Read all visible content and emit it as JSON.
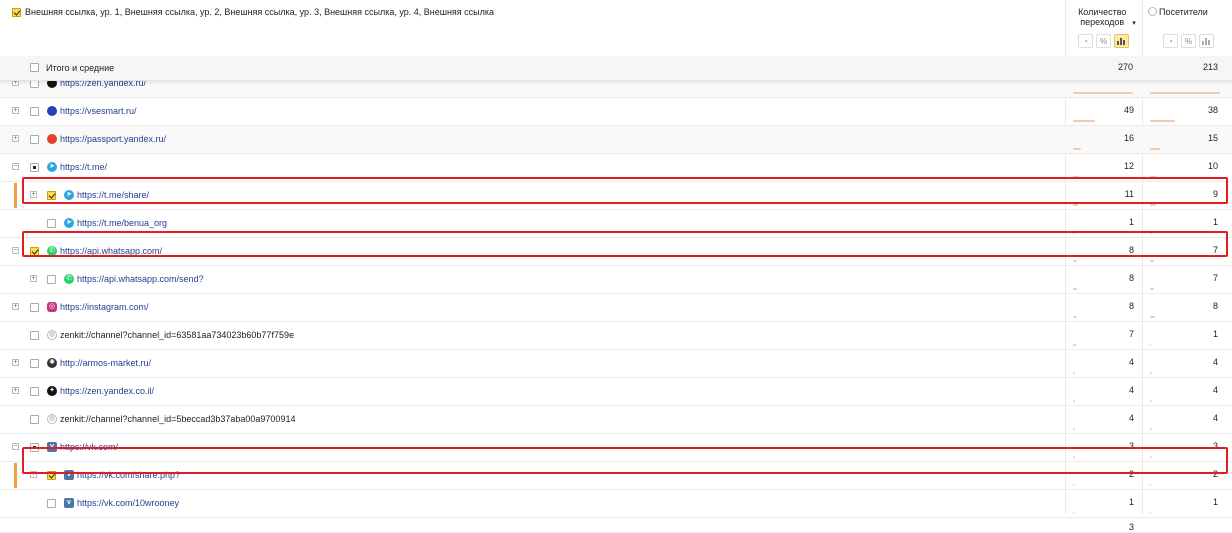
{
  "header": {
    "dimension_label": "Внешняя ссылка, ур. 1, Внешняя ссылка, ур. 2, Внешняя ссылка, ур. 3, Внешняя ссылка, ур. 4, Внешняя ссылка",
    "metric1_label": "Количество переходов",
    "metric1_sort": "▾",
    "metric2_label": "Посетители",
    "view_buttons": [
      "◔",
      "%",
      "📊"
    ]
  },
  "totals": {
    "label": "Итого и средние",
    "v1": "270",
    "v2": "213"
  },
  "rows": [
    {
      "url": "https://zen.yandex.ru/",
      "v1": "",
      "v2": "",
      "icon": "zen-icon",
      "iconColor": "#111"
    },
    {
      "url": "https://vsesmart.ru/",
      "v1": "49",
      "v2": "38",
      "icon": "vsesmart-icon",
      "iconColor": "#2a3dbf"
    },
    {
      "url": "https://passport.yandex.ru/",
      "v1": "16",
      "v2": "15",
      "icon": "yandex-icon",
      "iconColor": "#e8402a"
    },
    {
      "url": "https://t.me/",
      "v1": "12",
      "v2": "10",
      "icon": "telegram-icon",
      "iconColor": "#2ca5e0"
    },
    {
      "url": "https://t.me/share/",
      "v1": "11",
      "v2": "9",
      "icon": "telegram-icon",
      "iconColor": "#2ca5e0"
    },
    {
      "url": "https://t.me/benua_org",
      "v1": "1",
      "v2": "1",
      "icon": "telegram-icon",
      "iconColor": "#2ca5e0"
    },
    {
      "url": "https://api.whatsapp.com/",
      "v1": "8",
      "v2": "7",
      "icon": "whatsapp-icon",
      "iconColor": "#25d366"
    },
    {
      "url": "https://api.whatsapp.com/send?",
      "v1": "8",
      "v2": "7",
      "icon": "whatsapp-icon",
      "iconColor": "#25d366"
    },
    {
      "url": "https://instagram.com/",
      "v1": "8",
      "v2": "8",
      "icon": "instagram-icon",
      "iconColor": "#c13584"
    },
    {
      "url": "zenkit://channel?channel_id=63581aa734023b60b77f759e",
      "v1": "7",
      "v2": "1",
      "icon": "globe-icon",
      "iconColor": "#aaa"
    },
    {
      "url": "http://armos-market.ru/",
      "v1": "4",
      "v2": "4",
      "icon": "armos-icon",
      "iconColor": "#333"
    },
    {
      "url": "https://zen.yandex.co.il/",
      "v1": "4",
      "v2": "4",
      "icon": "zen-icon",
      "iconColor": "#111"
    },
    {
      "url": "zenkit://channel?channel_id=5beccad3b37aba00a9700914",
      "v1": "4",
      "v2": "4",
      "icon": "globe-icon",
      "iconColor": "#aaa"
    },
    {
      "url": "https://vk.com/",
      "v1": "3",
      "v2": "3",
      "icon": "vk-icon",
      "iconColor": "#4a76a8"
    },
    {
      "url": "https://vk.com/share.php?",
      "v1": "2",
      "v2": "2",
      "icon": "vk-icon",
      "iconColor": "#4a76a8"
    },
    {
      "url": "https://vk.com/10wrooney",
      "v1": "1",
      "v2": "1",
      "icon": "vk-icon",
      "iconColor": "#4a76a8"
    },
    {
      "url": "",
      "v1": "3",
      "v2": "",
      "icon": "",
      "iconColor": ""
    }
  ]
}
